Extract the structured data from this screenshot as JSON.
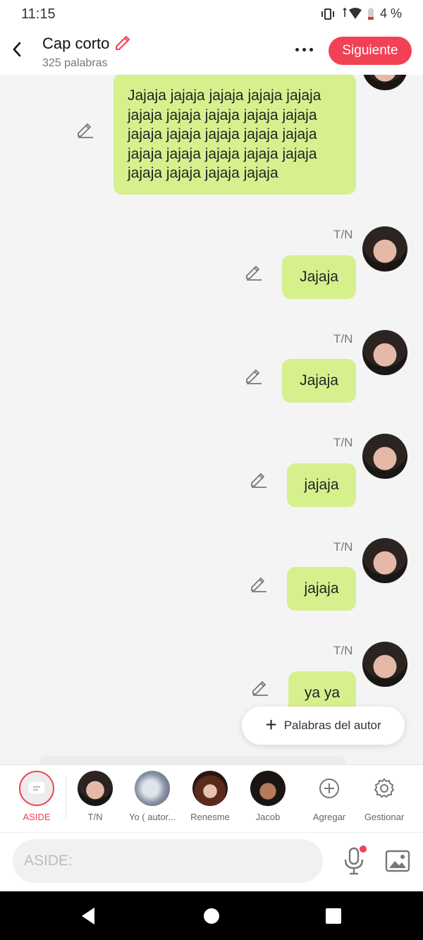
{
  "status": {
    "time": "11:15",
    "battery": "4 %"
  },
  "header": {
    "title": "Cap corto",
    "subtitle": "325 palabras",
    "next_label": "Siguiente"
  },
  "messages": {
    "first_text": "Jajaja jajaja jajaja jajaja jajaja jajaja jajaja jajaja jajaja jajaja jajaja jajaja jajaja jajaja jajaja jajaja jajaja jajaja jajaja jajaja jajaja jajaja jajaja jajaja",
    "items": [
      {
        "speaker": "T/N",
        "text": "Jajaja"
      },
      {
        "speaker": "T/N",
        "text": "Jajaja"
      },
      {
        "speaker": "T/N",
        "text": "jajaja"
      },
      {
        "speaker": "T/N",
        "text": "jajaja"
      },
      {
        "speaker": "T/N",
        "text": "ya ya"
      }
    ]
  },
  "author_words_label": "Palabras del autor",
  "characters": {
    "aside": "ASIDE",
    "list": [
      "T/N",
      "Yo ( autor...",
      "Renesme",
      "Jacob"
    ],
    "add": "Agregar",
    "manage": "Gestionar"
  },
  "input": {
    "placeholder": "ASIDE:"
  },
  "colors": {
    "accent": "#f24153",
    "bubble": "#d7f08e"
  },
  "icons": [
    "back-arrow-icon",
    "edit-pencil-icon",
    "more-dots-icon",
    "plus-icon",
    "settings-gear-icon",
    "microphone-icon",
    "image-icon"
  ]
}
